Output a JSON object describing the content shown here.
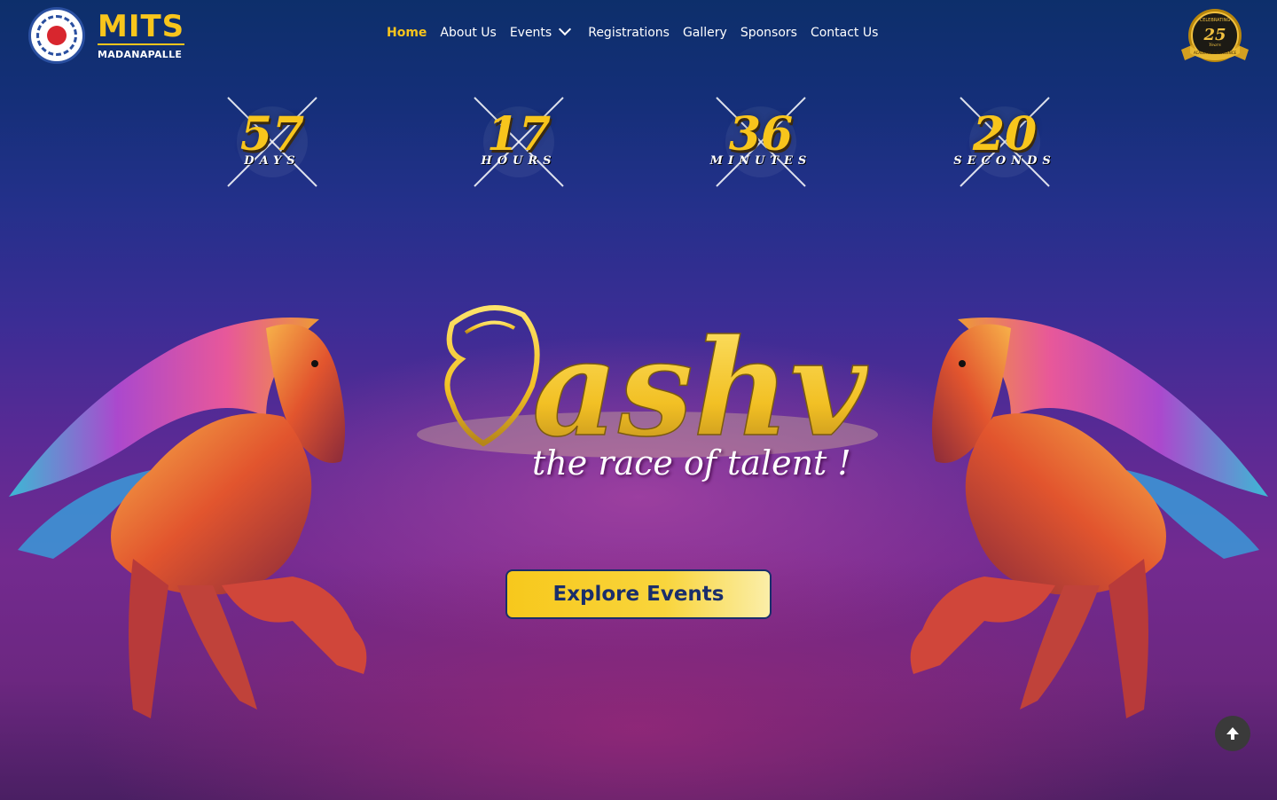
{
  "header": {
    "logo_title": "MITS",
    "logo_subtitle": "MADANAPALLE",
    "nav": [
      {
        "label": "Home",
        "active": true
      },
      {
        "label": "About Us"
      },
      {
        "label": "Events",
        "has_dropdown": true
      },
      {
        "label": "Registrations"
      },
      {
        "label": "Gallery"
      },
      {
        "label": "Sponsors"
      },
      {
        "label": "Contact Us"
      }
    ],
    "badge": {
      "top": "CELEBRATING",
      "number": "25",
      "years": "Years",
      "bottom": "ACADEMIC EXCELLENCE"
    }
  },
  "countdown": [
    {
      "value": "57",
      "label": "DAYS"
    },
    {
      "value": "17",
      "label": "HOURS"
    },
    {
      "value": "36",
      "label": "MINUTES"
    },
    {
      "value": "20",
      "label": "SECONDS"
    }
  ],
  "hero": {
    "brand": "ashv",
    "tagline": "the race of talent !",
    "cta_label": "Explore Events"
  },
  "colors": {
    "accent": "#f8c51c",
    "cta_text": "#1a2e6b",
    "bg_top": "#0d2f6b",
    "bg_bottom": "#6c2780"
  },
  "icons": {
    "scroll_top": "arrow-up-icon",
    "dropdown": "chevron-down-icon"
  }
}
